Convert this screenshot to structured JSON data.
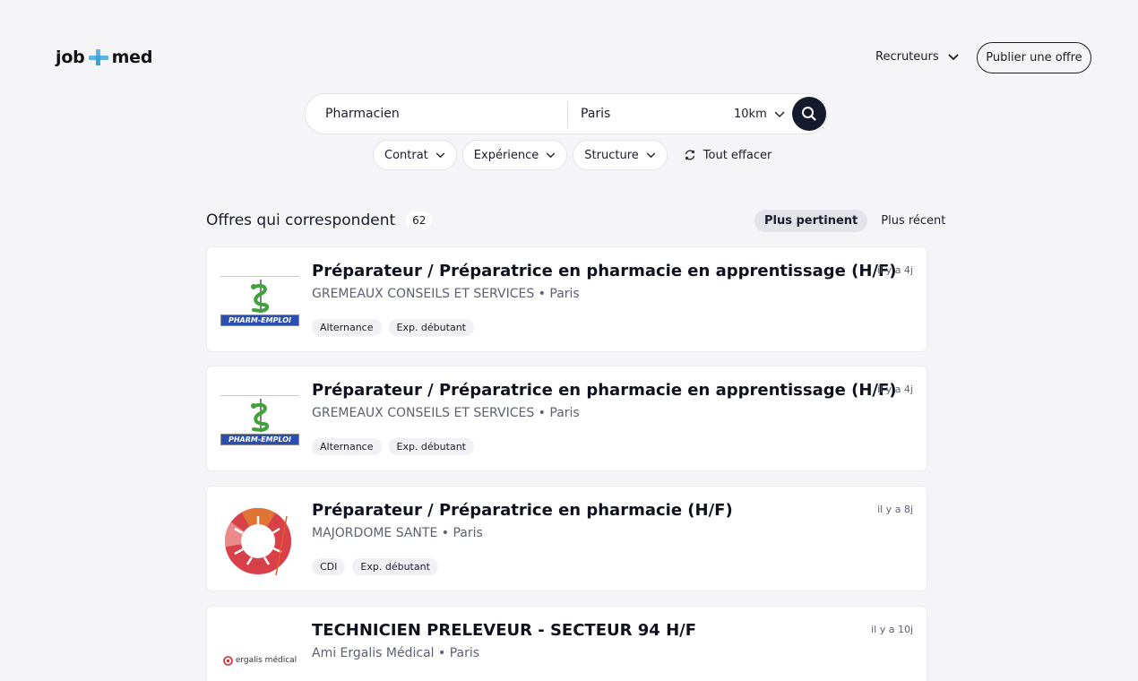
{
  "header": {
    "logo_left": "job",
    "logo_right": "med",
    "recruiters_label": "Recruteurs",
    "publish_label": "Publier une offre"
  },
  "search": {
    "query": "Pharmacien",
    "location": "Paris",
    "radius": "10km"
  },
  "filters": {
    "contract": "Contrat",
    "experience": "Expérience",
    "structure": "Structure",
    "clear": "Tout effacer"
  },
  "results": {
    "title": "Offres qui correspondent",
    "count": "62",
    "sort_relevant": "Plus pertinent",
    "sort_recent": "Plus récent",
    "jobs": [
      {
        "title": "Préparateur / Préparatrice en pharmacie en apprentissage (H/F)",
        "company": "GREMEAUX CONSEILS ET SERVICES • Paris",
        "date": "il y a 4j",
        "tags": [
          "Alternance",
          "Exp. débutant"
        ],
        "logo_text": "PHARM-EMPLOI"
      },
      {
        "title": "Préparateur / Préparatrice en pharmacie en apprentissage (H/F)",
        "company": "GREMEAUX CONSEILS ET SERVICES • Paris",
        "date": "il y a 4j",
        "tags": [
          "Alternance",
          "Exp. débutant"
        ],
        "logo_text": "PHARM-EMPLOI"
      },
      {
        "title": "Préparateur / Préparatrice en pharmacie (H/F)",
        "company": "MAJORDOME SANTE • Paris",
        "date": "il y a 8j",
        "tags": [
          "CDI",
          "Exp. débutant"
        ]
      },
      {
        "title": "TECHNICIEN PRELEVEUR - SECTEUR 94 H/F",
        "company": "Ami Ergalis Médical • Paris",
        "date": "il y a 10j",
        "tags": [],
        "logo_text": "ergalis médical"
      }
    ]
  },
  "colors": {
    "accent": "#5db4e4",
    "dark": "#161a2e",
    "background": "#f5f5f7"
  }
}
